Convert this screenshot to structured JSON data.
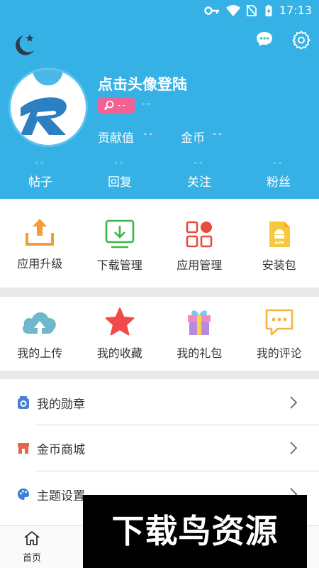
{
  "status_bar": {
    "time": "17:13"
  },
  "profile": {
    "login_prompt": "点击头像登陆",
    "badge_text": "--",
    "uid": "--",
    "contribution_label": "贡献值",
    "contribution_value": "--",
    "coins_label": "金币",
    "coins_value": "--"
  },
  "stats": [
    {
      "value": "--",
      "label": "帖子"
    },
    {
      "value": "--",
      "label": "回复"
    },
    {
      "value": "--",
      "label": "关注"
    },
    {
      "value": "--",
      "label": "粉丝"
    }
  ],
  "tools": [
    {
      "label": "应用升级",
      "icon": "upload-icon"
    },
    {
      "label": "下载管理",
      "icon": "download-icon"
    },
    {
      "label": "应用管理",
      "icon": "apps-icon"
    },
    {
      "label": "安装包",
      "icon": "apk-icon"
    }
  ],
  "mine": [
    {
      "label": "我的上传",
      "icon": "cloud-upload-icon"
    },
    {
      "label": "我的收藏",
      "icon": "star-icon"
    },
    {
      "label": "我的礼包",
      "icon": "gift-icon"
    },
    {
      "label": "我的评论",
      "icon": "comment-icon"
    }
  ],
  "menu": [
    {
      "label": "我的勋章",
      "icon": "medal-icon"
    },
    {
      "label": "金币商城",
      "icon": "shop-icon"
    },
    {
      "label": "主题设置",
      "icon": "palette-icon"
    }
  ],
  "tabbar": {
    "home_label": "首页"
  },
  "watermark_text": "下载鸟资源",
  "colors": {
    "header_bg": "#35b1e6",
    "badge_bg": "#f06292",
    "accent_orange": "#f39c38",
    "accent_green": "#3bb54a",
    "accent_red": "#e84c3d"
  }
}
